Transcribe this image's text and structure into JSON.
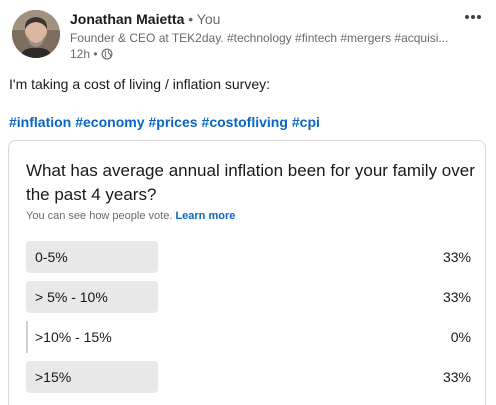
{
  "author": {
    "name": "Jonathan Maietta",
    "relation": "• You",
    "headline": "Founder & CEO at TEK2day. #technology #fintech #mergers #acquisi...",
    "time": "12h •",
    "visibility_icon": "globe-icon",
    "avatar_icon": "profile-photo"
  },
  "post": {
    "text": "I'm taking a cost of living / inflation survey:",
    "hashtags": [
      "#inflation",
      "#economy",
      "#prices",
      "#costofliving",
      "#cpi"
    ]
  },
  "poll": {
    "question": "What has average annual inflation been for your family over the past 4 years?",
    "note": "You can see how people vote.",
    "learn_more": "Learn more",
    "options": [
      {
        "label": "0-5%",
        "percent": "33%",
        "fraction": 0.33
      },
      {
        "label": "> 5% - 10%",
        "percent": "33%",
        "fraction": 0.33
      },
      {
        "label": ">10% - 15%",
        "percent": "0%",
        "fraction": 0
      },
      {
        "label": ">15%",
        "percent": "33%",
        "fraction": 0.33
      }
    ]
  },
  "colors": {
    "link": "#0a66c2",
    "bar": "#e8e8e8"
  },
  "menu_icon": "more-options-icon"
}
